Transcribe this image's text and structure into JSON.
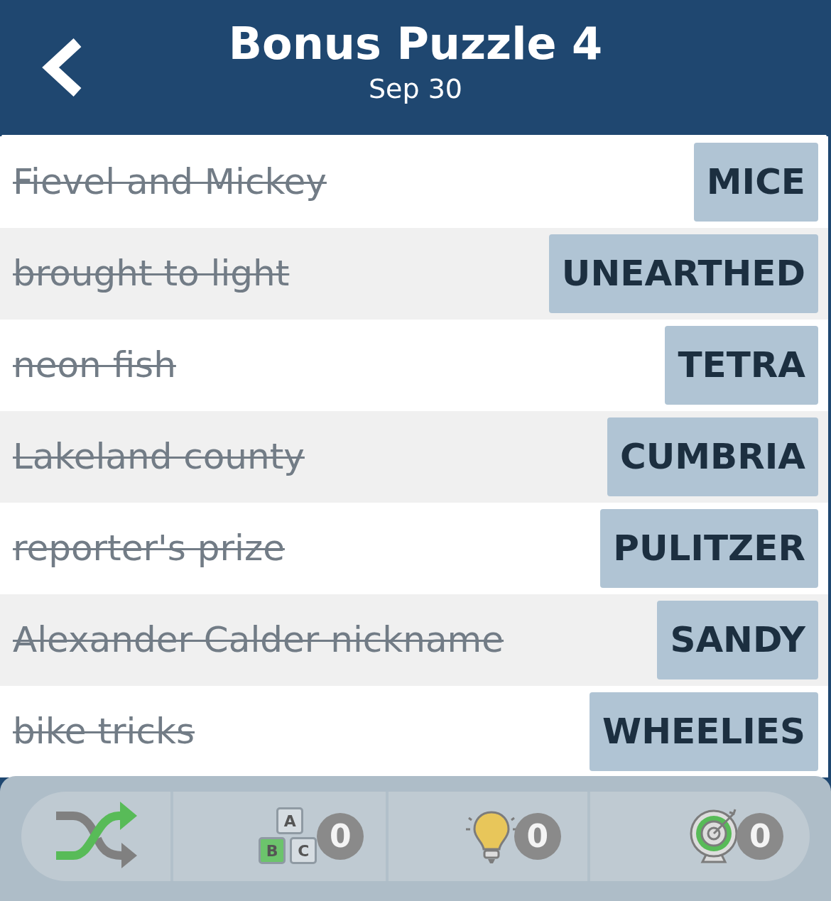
{
  "header": {
    "title": "Bonus Puzzle 4",
    "date": "Sep 30"
  },
  "clues": [
    {
      "clue": "Fievel and Mickey",
      "answer": "MICE",
      "solved": true
    },
    {
      "clue": "brought to light",
      "answer": "UNEARTHED",
      "solved": true
    },
    {
      "clue": "neon fish",
      "answer": "TETRA",
      "solved": true
    },
    {
      "clue": "Lakeland county",
      "answer": "CUMBRIA",
      "solved": true
    },
    {
      "clue": "reporter's prize",
      "answer": "PULITZER",
      "solved": true
    },
    {
      "clue": "Alexander Calder nickname",
      "answer": "SANDY",
      "solved": true
    },
    {
      "clue": "bike tricks",
      "answer": "WHEELIES",
      "solved": true
    }
  ],
  "toolbar": [
    {
      "kind": "shuffle"
    },
    {
      "kind": "letters",
      "blocks": [
        "A",
        "B",
        "C"
      ],
      "count": "0"
    },
    {
      "kind": "hint",
      "count": "0"
    },
    {
      "kind": "target",
      "count": "0"
    }
  ]
}
